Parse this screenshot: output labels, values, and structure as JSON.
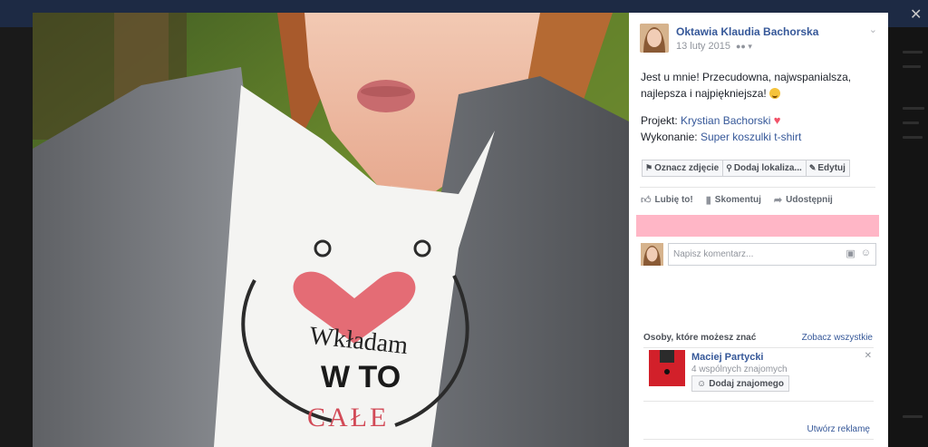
{
  "post": {
    "author": "Oktawia Klaudia Bachorska",
    "date": "13 luty 2015",
    "audience_icon": "friends-icon",
    "text_line1": "Jest u mnie! Przecudowna, najwspanialsza,",
    "text_line2": "najlepsza i najpiękniejsza!",
    "project_label": "Projekt:",
    "project_link": "Krystian Bachorski",
    "execution_label": "Wykonanie:",
    "execution_link": "Super koszulki t-shirt"
  },
  "tag_bar": {
    "tag_photo": "Oznacz zdjęcie",
    "add_location": "Dodaj lokaliza...",
    "edit": "Edytuj"
  },
  "actions": {
    "like": "Lubię to!",
    "comment": "Skomentuj",
    "share": "Udostępnij"
  },
  "comment": {
    "placeholder": "Napisz komentarz..."
  },
  "people_you_may_know": {
    "title": "Osoby, które możesz znać",
    "see_all": "Zobacz wszystkie",
    "person_name": "Maciej Partycki",
    "mutual": "4 wspólnych znajomych",
    "add_friend": "Dodaj znajomego"
  },
  "ads": {
    "create_ad": "Utwórz reklamę"
  },
  "photo": {
    "shirt_line1": "Wkładam",
    "shirt_line2": "W TO",
    "shirt_line3": "CAŁE"
  },
  "colors": {
    "link": "#365899",
    "pink_bar": "#ffb6c6",
    "heart": "#f25268"
  }
}
